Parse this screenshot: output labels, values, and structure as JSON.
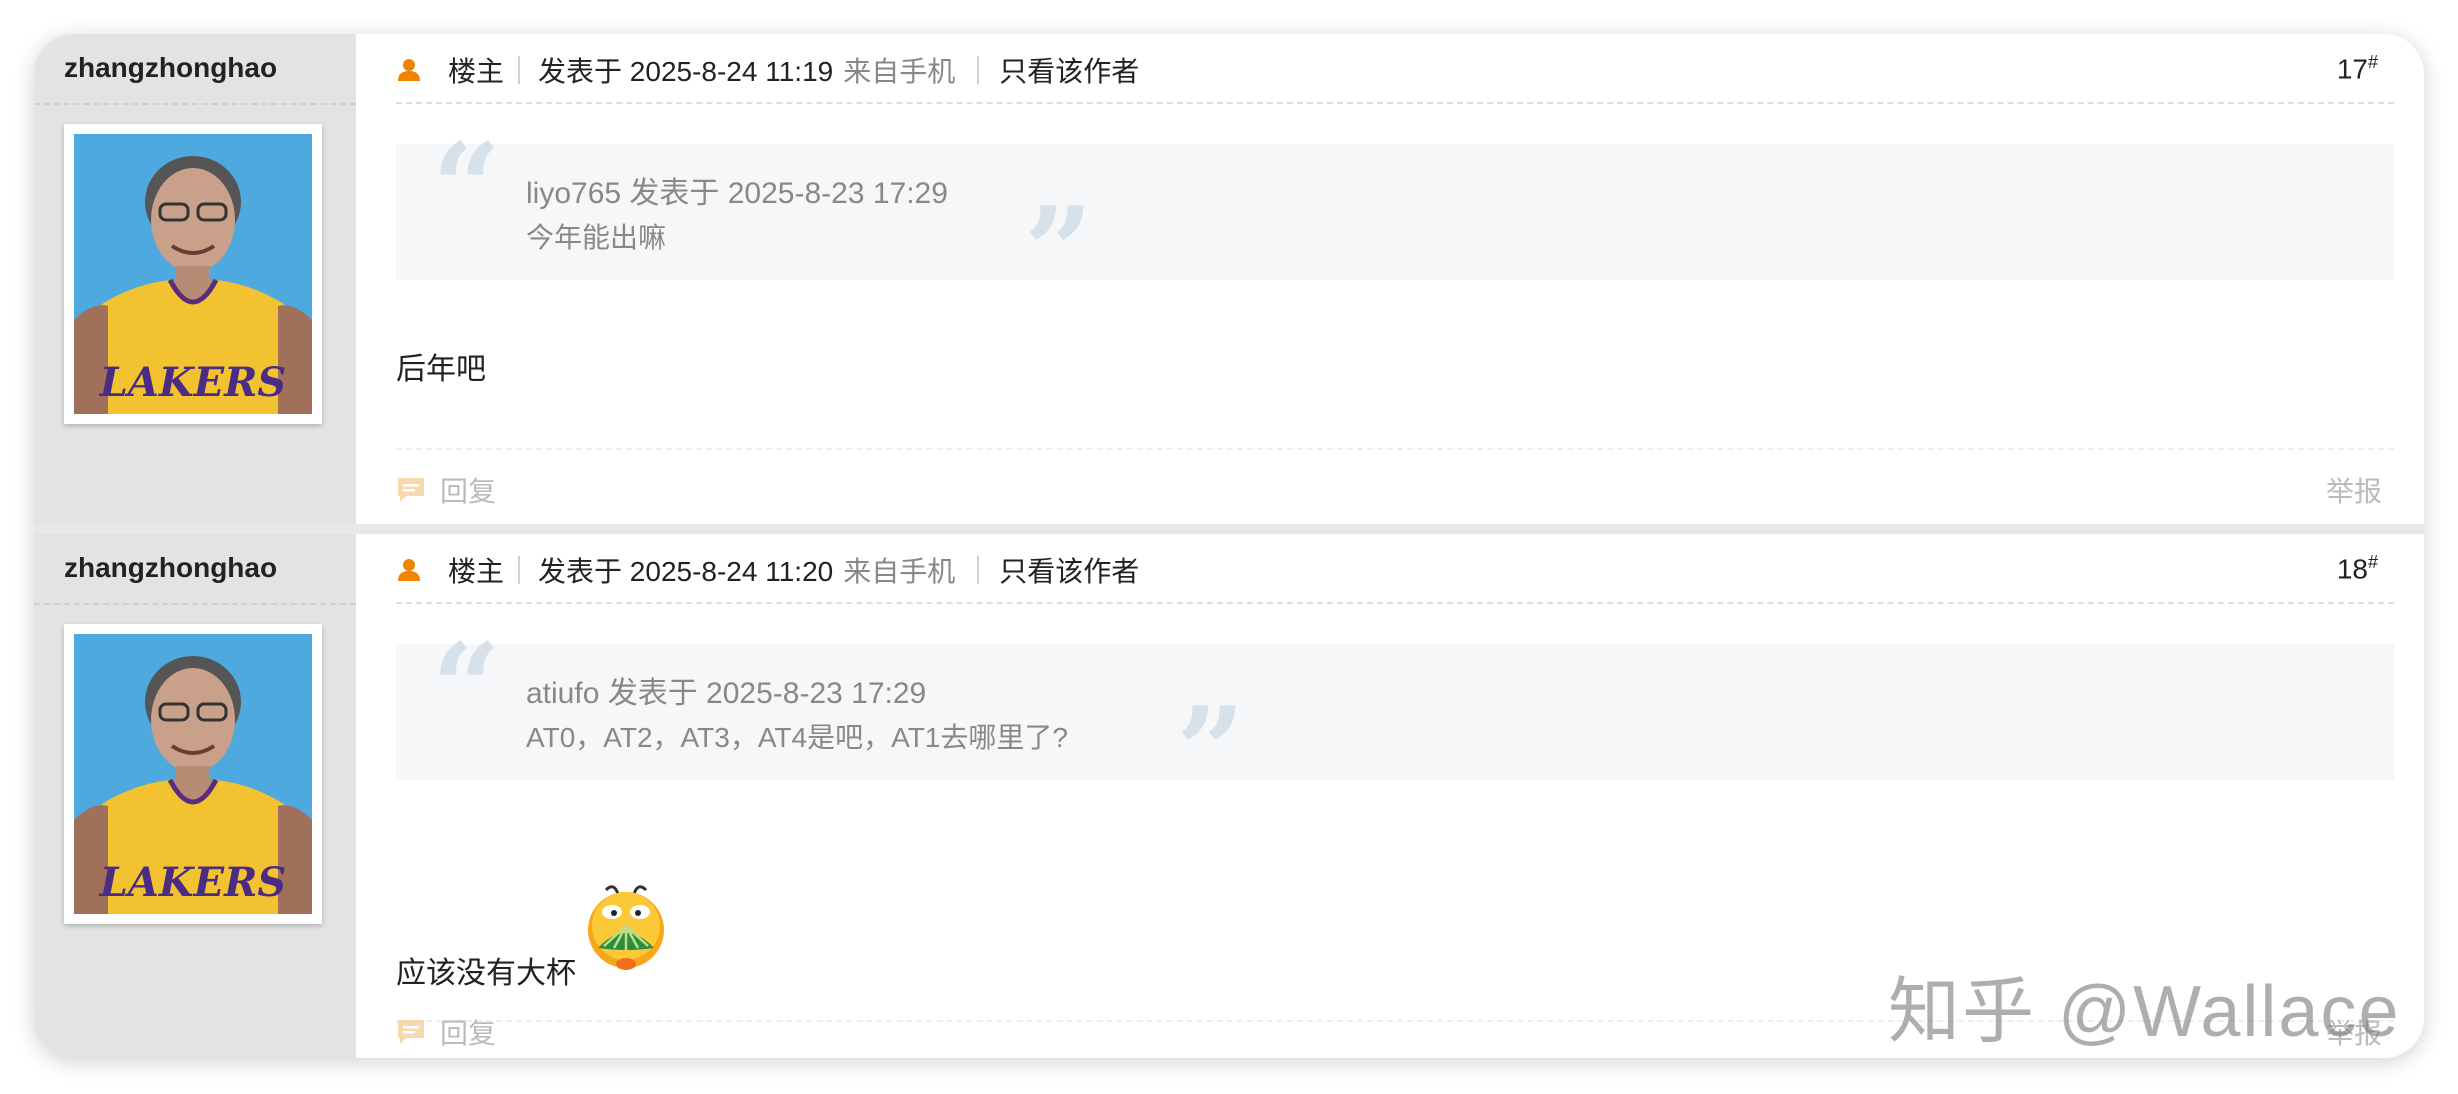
{
  "posts": [
    {
      "author": "zhangzhonghao",
      "role_label": "楼主",
      "posted_at": "发表于 2025-8-24 11:19",
      "source": "来自手机",
      "author_only": "只看该作者",
      "floor": "17",
      "floor_mark": "#",
      "quote": {
        "header": "liyo765 发表于 2025-8-23 17:29",
        "text": "今年能出嘛"
      },
      "body": "后年吧",
      "reply_label": "回复",
      "report_label": "举报"
    },
    {
      "author": "zhangzhonghao",
      "role_label": "楼主",
      "posted_at": "发表于 2025-8-24 11:20",
      "source": "来自手机",
      "author_only": "只看该作者",
      "floor": "18",
      "floor_mark": "#",
      "quote": {
        "header": "atiufo 发表于 2025-8-23 17:29",
        "text": "AT0，AT2，AT3，AT4是吧，AT1去哪里了?"
      },
      "body": "应该没有大杯",
      "reply_label": "回复",
      "report_label": "举报"
    }
  ],
  "avatar_jersey_text": "LAKERS",
  "watermark": "知乎 @Wallace",
  "colors": {
    "accent_orange": "#f08300",
    "sidebar_bg": "#e3e3e3",
    "quote_bg": "#f6f7f8",
    "quote_marks": "#d6e1ea",
    "muted_text": "#888888"
  },
  "icons": [
    "user-icon",
    "reply-icon",
    "crying-emoji"
  ]
}
